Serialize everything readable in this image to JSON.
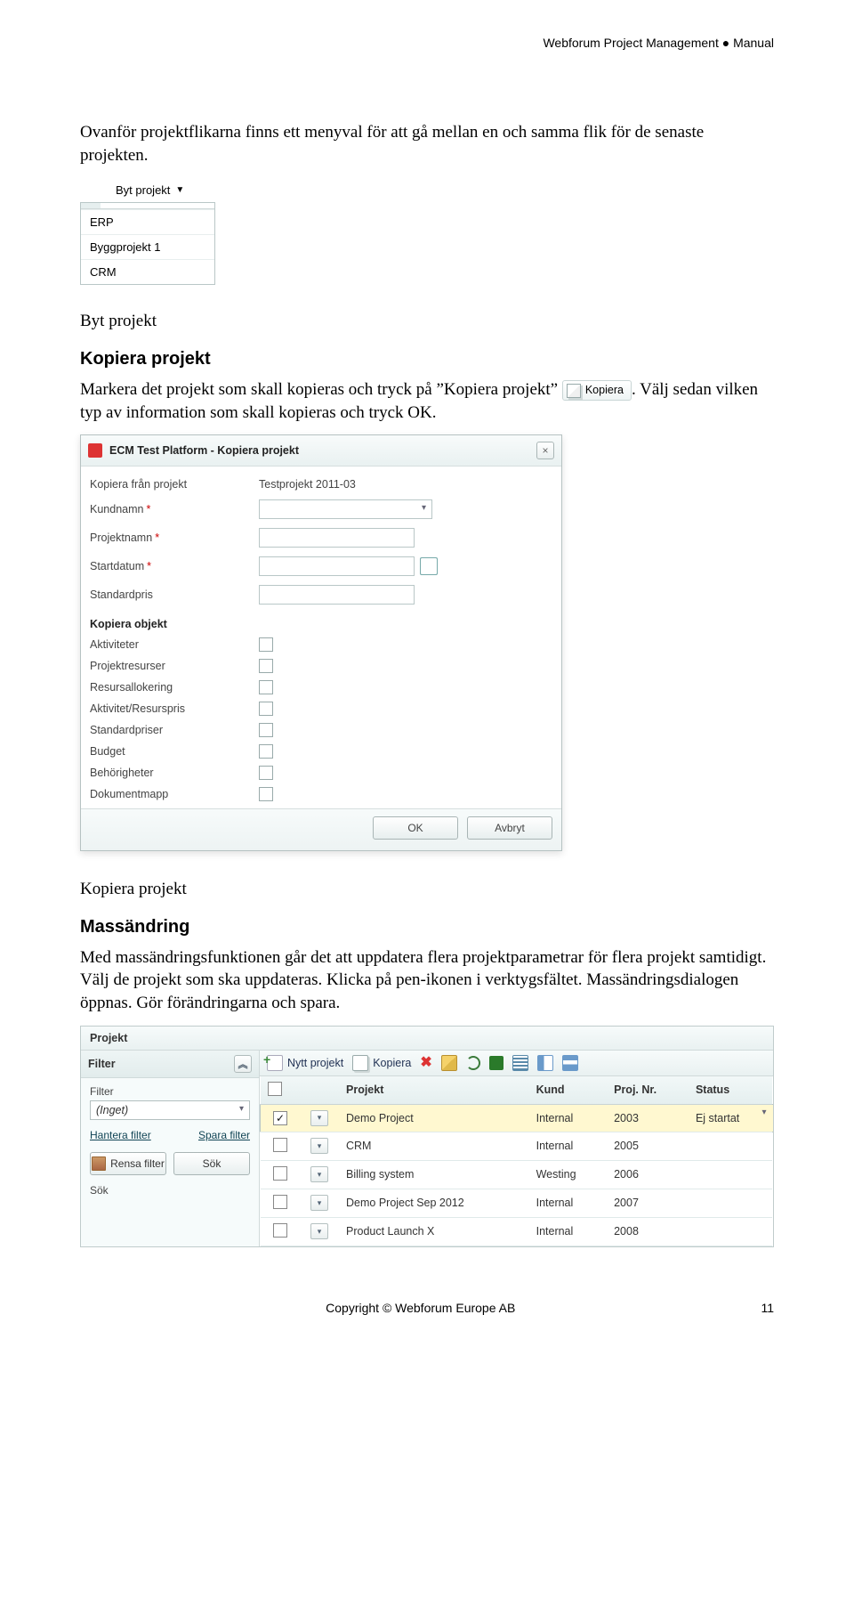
{
  "header_right": "Webforum Project Management ● Manual",
  "intro_para": "Ovanför projektflikarna finns ett menyval för att gå mellan en och samma flik för de senaste projekten.",
  "byt_projekt": {
    "label": "Byt projekt",
    "items": [
      "ERP",
      "Byggprojekt 1",
      "CRM"
    ]
  },
  "byt_caption": "Byt projekt",
  "kopiera_header": "Kopiera projekt",
  "kopiera_text_a": "Markera det projekt som skall kopieras och tryck på ”Kopiera projekt” ",
  "kopiera_chip_label": "Kopiera",
  "kopiera_text_b": ". Välj sedan vilken typ av information som skall kopieras och tryck OK.",
  "dialog": {
    "title": "ECM Test Platform - Kopiera projekt",
    "fields": {
      "from_label": "Kopiera från projekt",
      "from_value": "Testprojekt 2011-03",
      "kund_label": "Kundnamn",
      "projnamn_label": "Projektnamn",
      "start_label": "Startdatum",
      "stdpris_label": "Standardpris"
    },
    "section": "Kopiera objekt",
    "checks": [
      "Aktiviteter",
      "Projektresurser",
      "Resursallokering",
      "Aktivitet/Resurspris",
      "Standardpriser",
      "Budget",
      "Behörigheter",
      "Dokumentmapp"
    ],
    "ok": "OK",
    "cancel": "Avbryt"
  },
  "dialog_caption": "Kopiera projekt",
  "mass_header": "Massändring",
  "mass_para": "Med massändringsfunktionen går det att uppdatera flera projektparametrar för flera projekt samtidigt. Välj de projekt som ska uppdateras. Klicka på pen-ikonen i verktygsfältet. Massändringsdialogen öppnas. Gör förändringarna och spara.",
  "pane": {
    "title": "Projekt",
    "filter": {
      "head": "Filter",
      "label": "Filter",
      "value": "(Inget)",
      "link_manage": "Hantera filter",
      "link_save": "Spara filter",
      "btn_clear": "Rensa filter",
      "btn_search": "Sök",
      "search_label": "Sök"
    },
    "toolbar": {
      "new": "Nytt projekt",
      "copy": "Kopiera"
    },
    "columns": [
      "Projekt",
      "Kund",
      "Proj. Nr.",
      "Status"
    ],
    "rows": [
      {
        "checked": true,
        "name": "Demo Project",
        "kund": "Internal",
        "nr": "2003",
        "status": "Ej startat"
      },
      {
        "checked": false,
        "name": "CRM",
        "kund": "Internal",
        "nr": "2005",
        "status": ""
      },
      {
        "checked": false,
        "name": "Billing system",
        "kund": "Westing",
        "nr": "2006",
        "status": ""
      },
      {
        "checked": false,
        "name": "Demo Project Sep 2012",
        "kund": "Internal",
        "nr": "2007",
        "status": ""
      },
      {
        "checked": false,
        "name": "Product Launch X",
        "kund": "Internal",
        "nr": "2008",
        "status": ""
      }
    ]
  },
  "footer": {
    "copyright": "Copyright © Webforum Europe AB",
    "page": "11"
  }
}
